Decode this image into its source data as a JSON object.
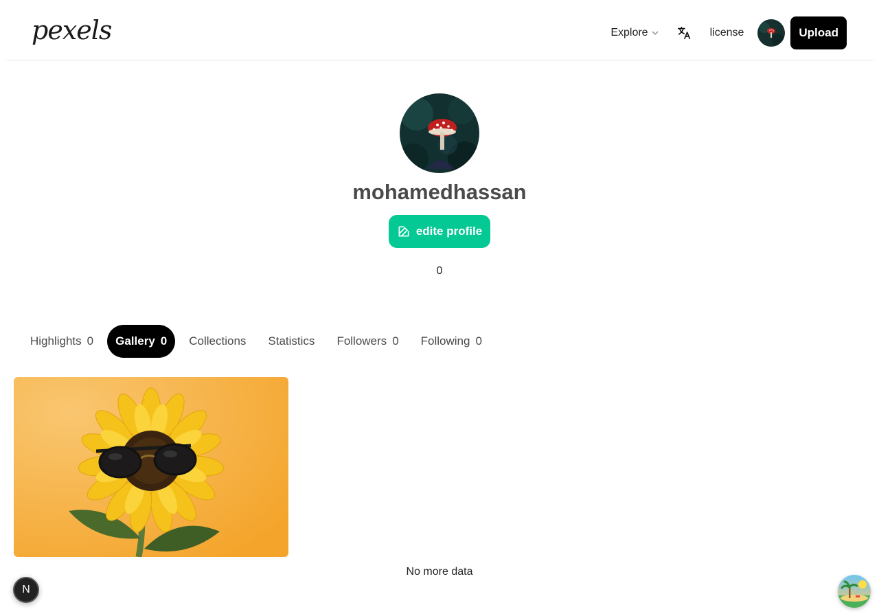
{
  "header": {
    "logo": "pexels",
    "explore_label": "Explore",
    "license_label": "license",
    "upload_label": "Upload"
  },
  "profile": {
    "username": "mohamedhassan",
    "edit_label": "edite profile",
    "count": "0"
  },
  "tabs": [
    {
      "label": "Highlights",
      "count": "0"
    },
    {
      "label": "Gallery",
      "count": "0",
      "active": true
    },
    {
      "label": "Collections",
      "count": ""
    },
    {
      "label": "Statistics",
      "count": ""
    },
    {
      "label": "Followers",
      "count": "0"
    },
    {
      "label": "Following",
      "count": "0"
    }
  ],
  "gallery": {
    "end_message": "No more data"
  },
  "floating": {
    "next_badge": "N"
  },
  "colors": {
    "accent": "#05c994",
    "upload_bg": "#000000",
    "username": "#4a4a4a",
    "photo_bg": "#f6a830"
  }
}
